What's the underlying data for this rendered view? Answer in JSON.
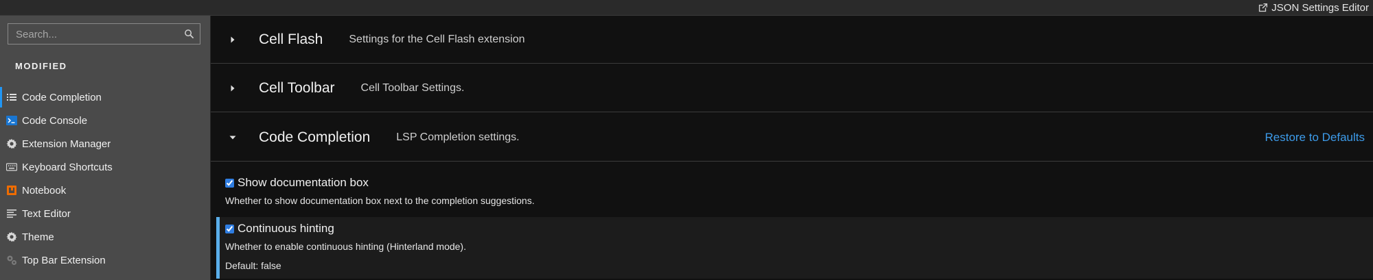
{
  "topbar": {
    "json_editor_label": "JSON Settings Editor"
  },
  "sidebar": {
    "search_placeholder": "Search...",
    "section_title": "MODIFIED",
    "items": [
      {
        "label": "Code Completion",
        "icon": "list-icon",
        "active": true
      },
      {
        "label": "Code Console",
        "icon": "console-icon"
      },
      {
        "label": "Extension Manager",
        "icon": "gear-icon"
      },
      {
        "label": "Keyboard Shortcuts",
        "icon": "keyboard-icon"
      },
      {
        "label": "Notebook",
        "icon": "notebook-icon"
      },
      {
        "label": "Text Editor",
        "icon": "text-editor-icon"
      },
      {
        "label": "Theme",
        "icon": "gear-icon"
      },
      {
        "label": "Top Bar Extension",
        "icon": "gears-icon"
      }
    ]
  },
  "panels": [
    {
      "title": "Cell Flash",
      "description": "Settings for the Cell Flash extension",
      "expanded": false
    },
    {
      "title": "Cell Toolbar",
      "description": "Cell Toolbar Settings.",
      "expanded": false
    },
    {
      "title": "Code Completion",
      "description": "LSP Completion settings.",
      "expanded": true,
      "restore_label": "Restore to Defaults"
    }
  ],
  "settings": [
    {
      "label": "Show documentation box",
      "checked": true,
      "description": "Whether to show documentation box next to the completion suggestions."
    },
    {
      "label": "Continuous hinting",
      "checked": true,
      "description": "Whether to enable continuous hinting (Hinterland mode).",
      "default_text": "Default: false",
      "modified": true
    }
  ],
  "colors": {
    "accent": "#2196f3",
    "link": "#3d9be9",
    "modified_bar": "#5aaeea"
  }
}
